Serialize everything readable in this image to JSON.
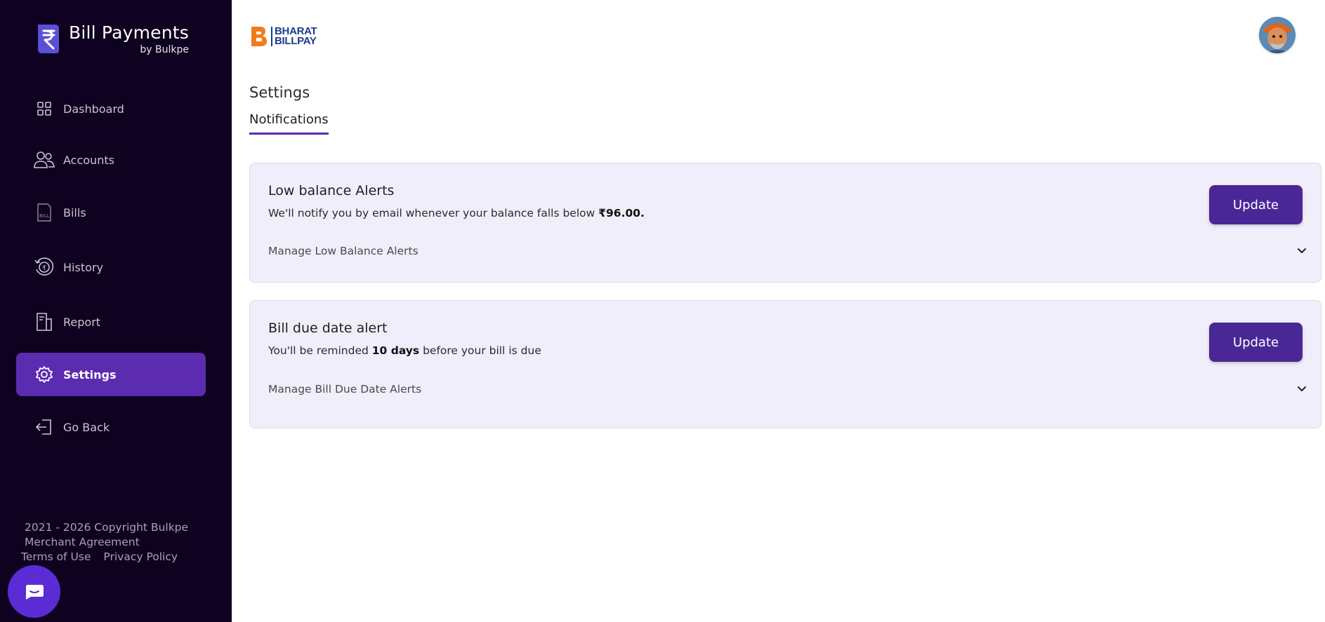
{
  "sidebar": {
    "brand_title": "Bill Payments",
    "brand_sub": "by Bulkpe",
    "items": [
      {
        "label": "Dashboard",
        "icon": "dashboard-icon"
      },
      {
        "label": "Accounts",
        "icon": "accounts-icon"
      },
      {
        "label": "Bills",
        "icon": "bill-icon"
      },
      {
        "label": "History",
        "icon": "history-icon"
      },
      {
        "label": "Report",
        "icon": "report-icon"
      },
      {
        "label": "Settings",
        "icon": "gear-icon",
        "active": true
      },
      {
        "label": "Go Back",
        "icon": "logout-icon"
      }
    ],
    "footer": {
      "copyright": "2021 - 2026 Copyright Bulkpe",
      "merchant": "Merchant Agreement",
      "terms": "Terms of Use",
      "privacy": "Privacy Policy"
    }
  },
  "header": {
    "logo_line1": "BHARAT",
    "logo_line2": "BILLPAY"
  },
  "main": {
    "title": "Settings",
    "tab": "Notifications",
    "cards": [
      {
        "title": "Low balance Alerts",
        "desc_prefix": "We'll notify you by email whenever your balance falls below ",
        "desc_bold": "₹96.00.",
        "desc_suffix": "",
        "button": "Update",
        "manage": "Manage Low Balance Alerts"
      },
      {
        "title": "Bill due date alert",
        "desc_prefix": "You'll be reminded ",
        "desc_bold": "10 days",
        "desc_suffix": " before your bill is due",
        "button": "Update",
        "manage": "Manage Bill Due Date Alerts"
      }
    ]
  },
  "colors": {
    "sidebar_bg": "#0e0220",
    "accent": "#5b2bb0",
    "button": "#4a2796",
    "card_bg": "#f1eefb"
  }
}
